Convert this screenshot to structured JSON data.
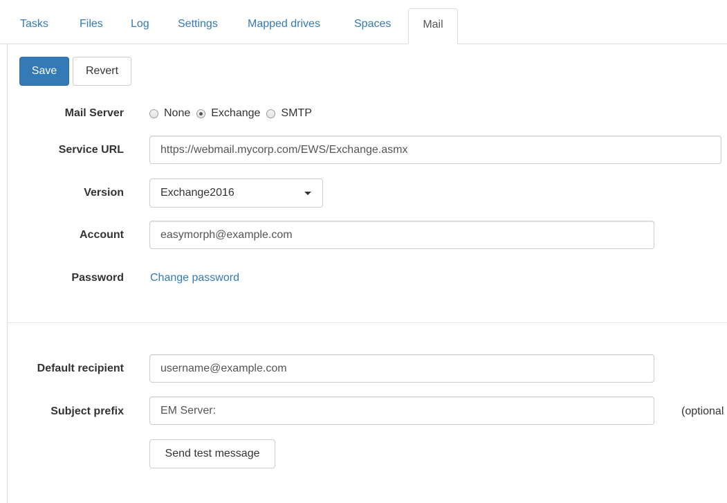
{
  "tabs": {
    "items": [
      {
        "label": "Tasks"
      },
      {
        "label": "Files"
      },
      {
        "label": "Log"
      },
      {
        "label": "Settings"
      },
      {
        "label": "Mapped drives"
      },
      {
        "label": "Spaces"
      },
      {
        "label": "Mail"
      }
    ],
    "active": "Mail"
  },
  "toolbar": {
    "save_label": "Save",
    "revert_label": "Revert"
  },
  "form": {
    "mail_server": {
      "label": "Mail Server",
      "options": [
        "None",
        "Exchange",
        "SMTP"
      ],
      "selected": "Exchange"
    },
    "service_url": {
      "label": "Service URL",
      "value": "https://webmail.mycorp.com/EWS/Exchange.asmx"
    },
    "version": {
      "label": "Version",
      "value": "Exchange2016"
    },
    "account": {
      "label": "Account",
      "value": "easymorph@example.com"
    },
    "password": {
      "label": "Password",
      "link_label": "Change password"
    },
    "default_recipient": {
      "label": "Default recipient",
      "value": "username@example.com"
    },
    "subject_prefix": {
      "label": "Subject prefix",
      "value": "EM Server:",
      "hint": "(optional"
    },
    "send_test_label": "Send test message"
  },
  "colors": {
    "primary": "#337ab7",
    "link": "#337ab7",
    "border": "#cccccc"
  }
}
